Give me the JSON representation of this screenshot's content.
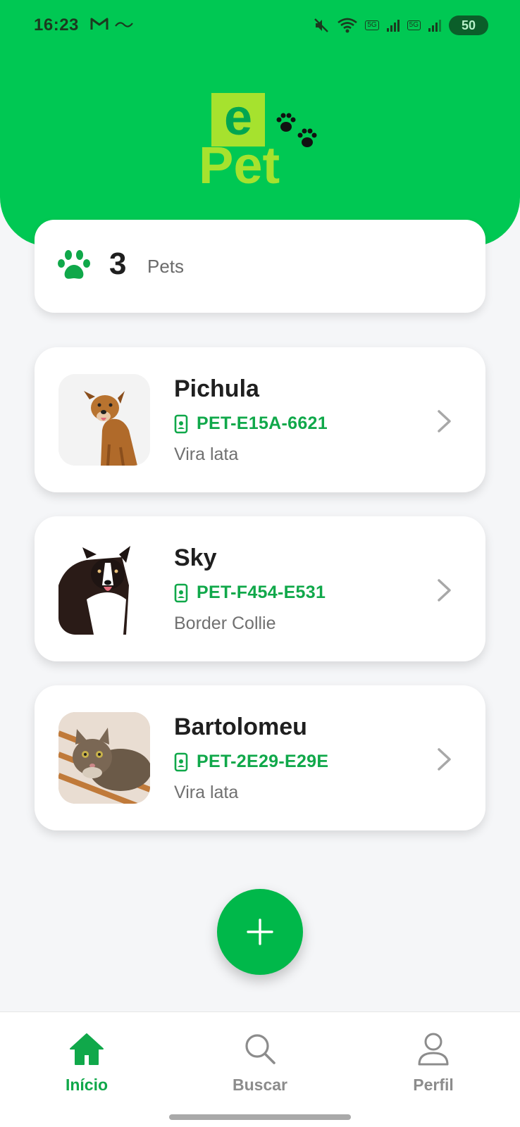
{
  "status_bar": {
    "time": "16:23",
    "battery": "50"
  },
  "summary": {
    "count": "3",
    "label": "Pets"
  },
  "pets": [
    {
      "name": "Pichula",
      "id": "PET-E15A-6621",
      "breed": "Vira lata",
      "photo_icon": "dog-photo"
    },
    {
      "name": "Sky",
      "id": "PET-F454-E531",
      "breed": "Border Collie",
      "photo_icon": "dog-photo"
    },
    {
      "name": "Bartolomeu",
      "id": "PET-2E29-E29E",
      "breed": "Vira lata",
      "photo_icon": "cat-photo"
    }
  ],
  "nav": {
    "home": "Início",
    "search": "Buscar",
    "profile": "Perfil"
  },
  "colors": {
    "brand_green": "#00C853",
    "accent_green": "#10A84A",
    "logo_lime": "#A6E22E"
  }
}
